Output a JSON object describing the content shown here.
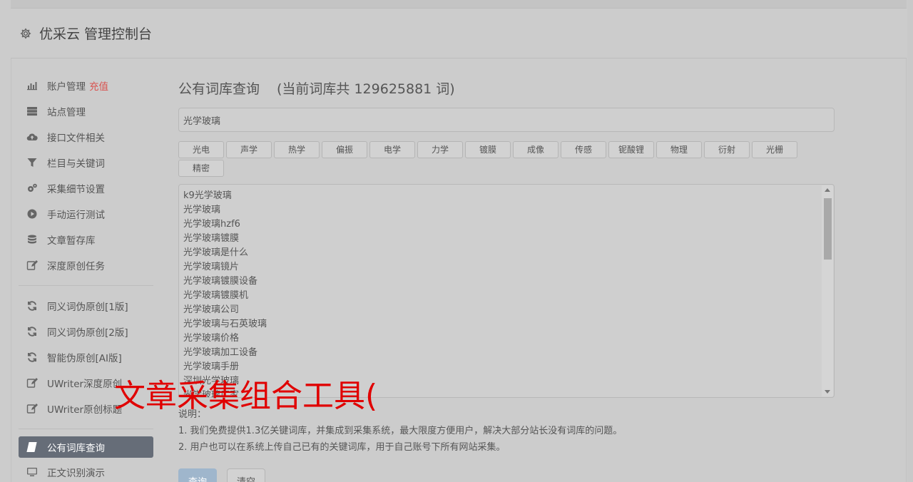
{
  "app": {
    "title": "优采云 管理控制台"
  },
  "sidebar": {
    "group1": [
      {
        "label": "账户管理",
        "badge": "充值",
        "icon": "bar-chart-icon"
      },
      {
        "label": "站点管理",
        "icon": "server-icon"
      },
      {
        "label": "接口文件相关",
        "icon": "cloud-upload-icon"
      },
      {
        "label": "栏目与关键词",
        "icon": "filter-icon"
      },
      {
        "label": "采集细节设置",
        "icon": "gears-icon"
      },
      {
        "label": "手动运行测试",
        "icon": "play-circle-icon"
      },
      {
        "label": "文章暂存库",
        "icon": "database-icon"
      },
      {
        "label": "深度原创任务",
        "icon": "edit-icon"
      }
    ],
    "group2": [
      {
        "label": "同义词伪原创[1版]",
        "icon": "refresh-icon"
      },
      {
        "label": "同义词伪原创[2版]",
        "icon": "refresh-icon"
      },
      {
        "label": "智能伪原创[AI版]",
        "icon": "refresh-icon"
      },
      {
        "label": "UWriter深度原创",
        "icon": "edit-icon"
      },
      {
        "label": "UWriter原创标题",
        "icon": "edit-icon"
      }
    ],
    "group3": [
      {
        "label": "公有词库查询",
        "icon": "book-icon",
        "active": true
      },
      {
        "label": "正文识别演示",
        "icon": "monitor-icon"
      }
    ]
  },
  "main": {
    "title": "公有词库查询",
    "count_text": "(当前词库共 129625881 词)",
    "search_value": "光学玻璃",
    "tags": [
      "光电",
      "声学",
      "热学",
      "偏振",
      "电学",
      "力学",
      "镀膜",
      "成像",
      "传感",
      "铌酸锂",
      "物理",
      "衍射",
      "光栅",
      "精密"
    ],
    "results": [
      "k9光学玻璃",
      "光学玻璃",
      "光学玻璃hzf6",
      "光学玻璃镀膜",
      "光学玻璃是什么",
      "光学玻璃镜片",
      "光学玻璃镀膜设备",
      "光学玻璃镀膜机",
      "光学玻璃公司",
      "光学玻璃与石英玻璃",
      "光学玻璃价格",
      "光学玻璃加工设备",
      "光学玻璃手册",
      "深圳光学玻璃",
      "光学玻璃厂家"
    ],
    "notes": {
      "heading": "说明：",
      "line1": "1. 我们免费提供1.3亿关键词库，并集成到采集系统，最大限度方便用户，解决大部分站长没有词库的问题。",
      "line2": "2. 用户也可以在系统上传自己已有的关键词库，用于自己账号下所有网站采集。"
    },
    "buttons": {
      "query": "查询",
      "clear": "清空"
    }
  },
  "overlay_text": "文章采集组合工具(",
  "colors": {
    "accent_active": "#666d78",
    "badge": "#d9534f",
    "overlay": "#e00000",
    "query_button": "#9fb6cc"
  }
}
